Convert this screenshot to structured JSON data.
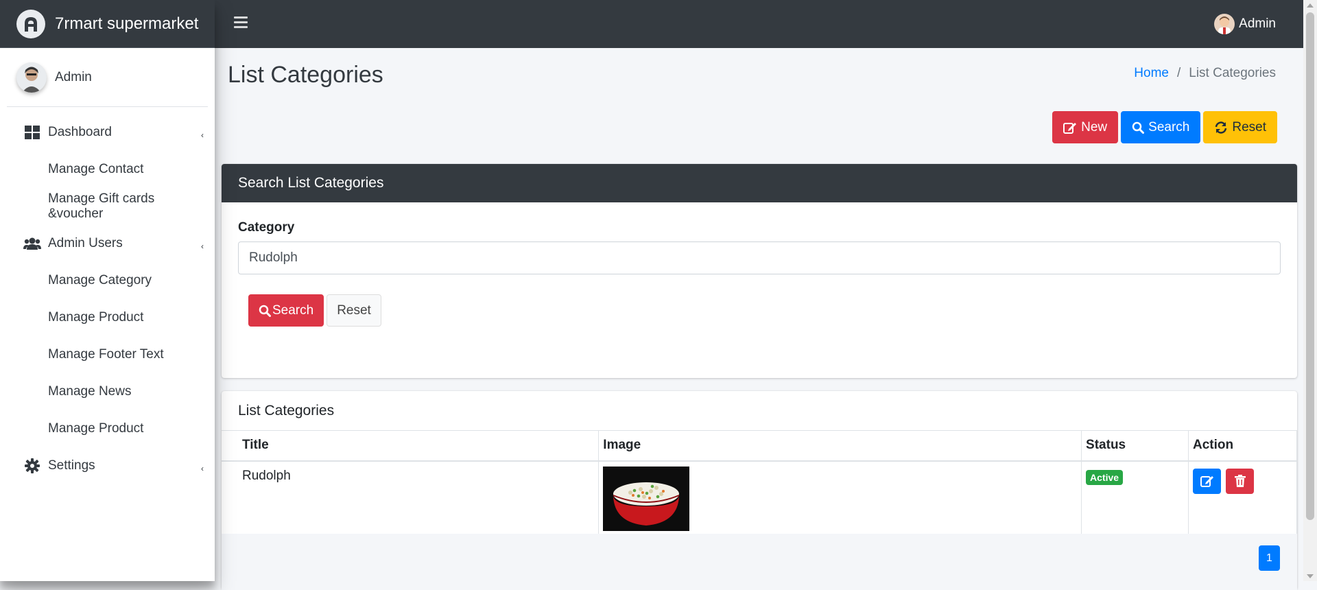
{
  "brand": {
    "name": "7rmart supermarket"
  },
  "sidebar": {
    "user_name": "Admin",
    "items": [
      {
        "label": "Dashboard",
        "icon": "dashboard-icon",
        "has_caret": true
      },
      {
        "label": "Manage Contact"
      },
      {
        "label": "Manage Gift cards &voucher"
      },
      {
        "label": "Admin Users",
        "icon": "users-icon",
        "has_caret": true
      },
      {
        "label": "Manage Category"
      },
      {
        "label": "Manage Product"
      },
      {
        "label": "Manage Footer Text"
      },
      {
        "label": "Manage News"
      },
      {
        "label": "Manage Product"
      },
      {
        "label": "Settings",
        "icon": "gear-icon",
        "has_caret": true
      }
    ]
  },
  "topbar": {
    "user_name": "Admin"
  },
  "page": {
    "title": "List Categories",
    "breadcrumb": {
      "home": "Home",
      "current": "List Categories"
    }
  },
  "actions": {
    "new_label": "New",
    "search_label": "Search",
    "reset_label": "Reset"
  },
  "search_card": {
    "title": "Search List Categories",
    "category_label": "Category",
    "category_value": "Rudolph",
    "search_button": "Search",
    "reset_button": "Reset"
  },
  "list_card": {
    "title": "List Categories",
    "columns": [
      "Title",
      "Image",
      "Status",
      "Action"
    ],
    "rows": [
      {
        "title": "Rudolph",
        "image": "fried-rice-bowl",
        "status": "Active"
      }
    ],
    "pagination": {
      "current_page": "1"
    }
  },
  "colors": {
    "danger": "#dc3545",
    "primary": "#007bff",
    "warning": "#ffc107",
    "success": "#28a745",
    "dark": "#343a40"
  }
}
